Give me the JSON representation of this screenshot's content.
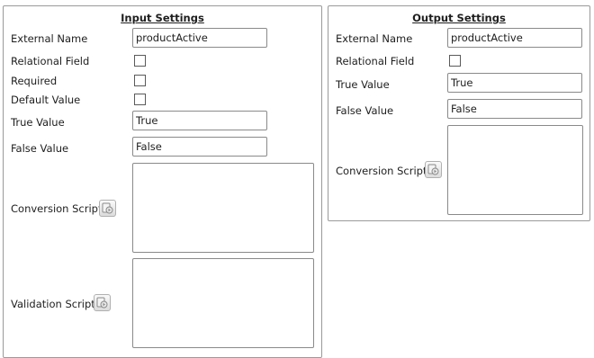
{
  "input": {
    "title": "Input Settings",
    "external_name_label": "External Name",
    "external_name_value": "productActive",
    "relational_field_label": "Relational Field",
    "required_label": "Required",
    "default_value_label": "Default Value",
    "true_value_label": "True Value",
    "true_value_value": "True",
    "false_value_label": "False Value",
    "false_value_value": "False",
    "conversion_script_label": "Conversion Script",
    "validation_script_label": "Validation Script"
  },
  "output": {
    "title": "Output Settings",
    "external_name_label": "External Name",
    "external_name_value": "productActive",
    "relational_field_label": "Relational Field",
    "true_value_label": "True Value",
    "true_value_value": "True",
    "false_value_label": "False Value",
    "false_value_value": "False",
    "conversion_script_label": "Conversion Script"
  },
  "icons": {
    "script_edit": "script-edit-icon"
  }
}
